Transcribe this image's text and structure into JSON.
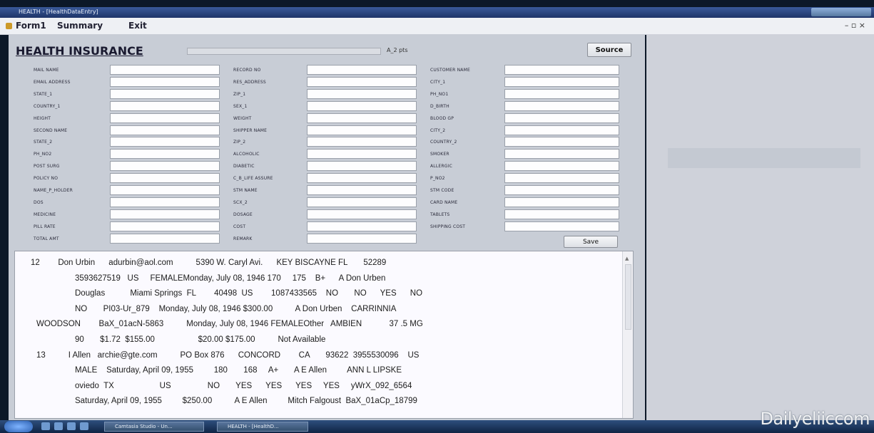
{
  "window": {
    "title": "HEALTH - [HealthDataEntry]"
  },
  "menu": {
    "items": [
      "Form1",
      "Summary",
      "Exit"
    ]
  },
  "form": {
    "heading": "HEALTH INSURANCE",
    "status": "A_2 pts",
    "source_button": "Source",
    "save_button": "Save",
    "col1_labels": [
      "MAIL NAME",
      "EMAIL ADDRESS",
      "STATE_1",
      "COUNTRY_1",
      "HEIGHT",
      "SECOND NAME",
      "STATE_2",
      "PH_NO2",
      "POST SURG",
      "POLICY NO",
      "NAME_P_HOLDER",
      "DOS",
      "MEDICINE",
      "PILL RATE",
      "TOTAL AMT"
    ],
    "col2_labels": [
      "RECORD NO",
      "RES_ADDRESS",
      "ZIP_1",
      "SEX_1",
      "WEIGHT",
      "SHIPPER NAME",
      "ZIP_2",
      "ALCOHOLIC",
      "DIABETIC",
      "C_B_LIFE ASSURE",
      "STM NAME",
      "SCX_2",
      "DOSAGE",
      "COST",
      "REMARK"
    ],
    "col3_labels": [
      "CUSTOMER NAME",
      "CITY_1",
      "PH_NO1",
      "D_BIRTH",
      "BLOOD GP",
      "CITY_2",
      "COUNTRY_2",
      "SMOKER",
      "ALLERGIC",
      "P_NO2",
      "STM CODE",
      "CARD NAME",
      "TABLETS",
      "SHIPPING COST"
    ]
  },
  "records": {
    "lines": [
      {
        "indent": 42,
        "text": "12        Don Urbin      adurbin@aol.com          5390 W. Caryl Avi.      KEY BISCAYNE FL       52289"
      },
      {
        "indent": 104,
        "text": "3593627519   US     FEMALEMonday, July 08, 1946 170     175    B+      A Don Urben"
      },
      {
        "indent": 104,
        "text": "Douglas           Miami Springs  FL        40498  US        1087433565    NO       NO      YES      NO"
      },
      {
        "indent": 104,
        "text": "NO       PI03-Ur_879    Monday, July 08, 1946 $300.00          A Don Urben    CARRINNIA"
      },
      {
        "indent": 50,
        "text": "WOODSON        BaX_01acN-5863          Monday, July 08, 1946 FEMALEOther   AMBIEN            37 .5 MG"
      },
      {
        "indent": 104,
        "text": "90       $1.72  $155.00                   $20.00 $175.00          Not Available"
      },
      {
        "indent": 50,
        "text": "13          I Allen   archie@gte.com          PO Box 876      CONCORD        CA       93622  3955530096    US"
      },
      {
        "indent": 104,
        "text": "MALE    Saturday, April 09, 1955         180       168     A+       A E Allen         ANN L LIPSKE"
      },
      {
        "indent": 104,
        "text": "oviedo  TX                    US                NO       YES      YES      YES     YES     yWrX_092_6564"
      },
      {
        "indent": 104,
        "text": "Saturday, April 09, 1955         $250.00          A E Allen         Mitch Falgoust  BaX_01aCp_18799"
      }
    ]
  },
  "taskbar": {
    "tasks": [
      "Camtasia Studio - Un...",
      "HEALTH - [HealthD..."
    ]
  },
  "watermark": "Dailyeliiccom"
}
